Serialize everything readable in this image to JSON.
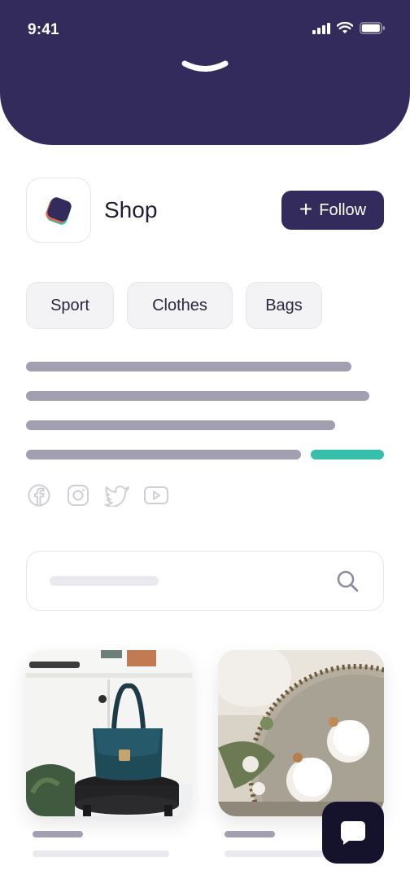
{
  "status_bar": {
    "time": "9:41"
  },
  "shop": {
    "name": "Shop",
    "follow_label": "Follow"
  },
  "tags": [
    "Sport",
    "Clothes",
    "Bags"
  ],
  "icons": {
    "header": "chevron-down-icon",
    "social": [
      "facebook-icon",
      "instagram-icon",
      "twitter-icon",
      "youtube-icon"
    ],
    "search": "search-icon",
    "chat": "chat-icon"
  },
  "products": [
    {
      "image": "teal leather handbag on black stool"
    },
    {
      "image": "white round earrings on mirror tray"
    }
  ],
  "colors": {
    "header": "#332b5c",
    "button": "#332b5c",
    "accent": "#36bfaa",
    "chat_button": "#15122b",
    "placeholder": "#a19fb0"
  }
}
